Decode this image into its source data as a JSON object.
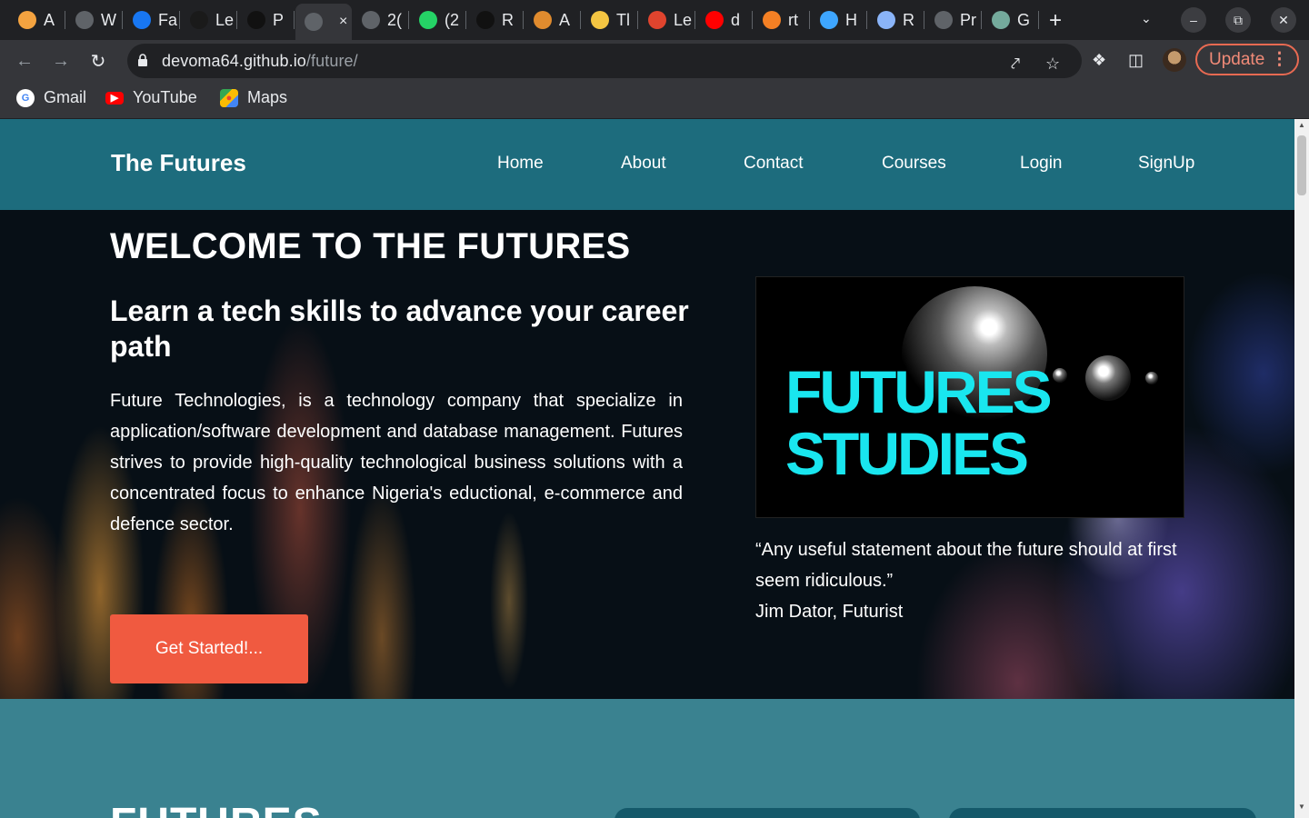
{
  "browser": {
    "tabs": [
      {
        "label": "A",
        "icon": "ai-icon",
        "color": "#f4a340"
      },
      {
        "label": "W",
        "icon": "globe-icon",
        "color": "#5f6368"
      },
      {
        "label": "Fa",
        "icon": "facebook-icon",
        "color": "#1877f2"
      },
      {
        "label": "Le",
        "icon": "ir-icon",
        "color": "#1a1a1a"
      },
      {
        "label": "P",
        "icon": "dark-icon",
        "color": "#111111"
      },
      {
        "label": "×",
        "icon": "globe-icon",
        "color": "#5f6368",
        "active": true
      },
      {
        "label": "2(",
        "icon": "globe-icon",
        "color": "#5f6368"
      },
      {
        "label": "(2",
        "icon": "counter-icon",
        "color": "#25d366"
      },
      {
        "label": "R",
        "icon": "e-icon",
        "color": "#111111"
      },
      {
        "label": "A",
        "icon": "fox-icon",
        "color": "#e08b2e"
      },
      {
        "label": "Tl",
        "icon": "note-icon",
        "color": "#f4c542"
      },
      {
        "label": "Le",
        "icon": "stripes-icon",
        "color": "#e0442e"
      },
      {
        "label": "d",
        "icon": "youtube-icon",
        "color": "#ff0000"
      },
      {
        "label": "rt",
        "icon": "stack-icon",
        "color": "#f48024"
      },
      {
        "label": "H",
        "icon": "loop-icon",
        "color": "#3ea6ff"
      },
      {
        "label": "R",
        "icon": "monitor-icon",
        "color": "#8ab4f8"
      },
      {
        "label": "Pr",
        "icon": "globe-icon",
        "color": "#5f6368"
      },
      {
        "label": "G",
        "icon": "openai-icon",
        "color": "#74aa9c"
      }
    ],
    "url_domain": "devoma64.github.io",
    "url_path": "/future/",
    "update_label": "Update",
    "bookmarks": [
      {
        "label": "Gmail",
        "icon": "google-icon"
      },
      {
        "label": "YouTube",
        "icon": "youtube-icon"
      },
      {
        "label": "Maps",
        "icon": "maps-icon"
      }
    ]
  },
  "site": {
    "brand": "The Futures",
    "nav": [
      "Home",
      "About",
      "Contact",
      "Courses",
      "Login",
      "SignUp"
    ],
    "hero": {
      "title": "WELCOME TO THE FUTURES",
      "subtitle": "Learn a tech skills to advance your career path",
      "description": "Future Technologies, is a technology company that specialize in application/software development and database management. Futures strives to provide high-quality technological business solutions with a concentrated focus to enhance Nigeria's eductional, e-commerce and defence sector.",
      "cta": "Get Started!...",
      "image_text_line1": "FUTURES",
      "image_text_line2": "STUDIES",
      "quote": "“Any useful statement about the future should at first seem ridiculous.”",
      "quote_author": "Jim Dator, Futurist"
    },
    "lower_title": "FUTURES"
  },
  "colors": {
    "nav_bg": "#1d6c7d",
    "page_bg": "#3a8290",
    "cta_bg": "#f05a40",
    "promo_text": "#19e6ef"
  }
}
